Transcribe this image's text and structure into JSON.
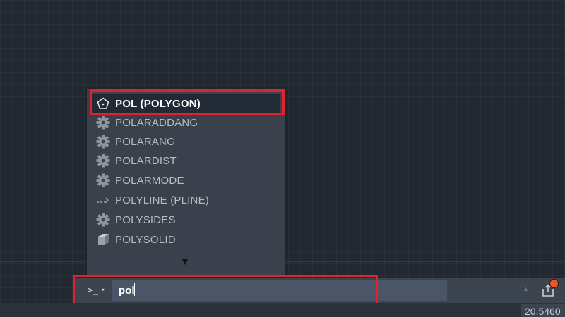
{
  "autocomplete": {
    "items": [
      {
        "label": "POL (POLYGON)",
        "icon": "polygon-icon",
        "selected": true
      },
      {
        "label": "POLARADDANG",
        "icon": "gear-icon"
      },
      {
        "label": "POLARANG",
        "icon": "gear-icon"
      },
      {
        "label": "POLARDIST",
        "icon": "gear-icon"
      },
      {
        "label": "POLARMODE",
        "icon": "gear-icon"
      },
      {
        "label": "POLYLINE (PLINE)",
        "icon": "polyline-icon"
      },
      {
        "label": "POLYSIDES",
        "icon": "gear-icon"
      },
      {
        "label": "POLYSOLID",
        "icon": "polysolid-icon"
      }
    ],
    "more_indicator": "▼"
  },
  "command_line": {
    "prompt_symbol": ">_",
    "dropdown_symbol": "▾",
    "input_value": "pol",
    "history_arrow": "▲"
  },
  "status": {
    "coordinate": "20.5460"
  },
  "colors": {
    "highlight_border": "#e0212e",
    "notification": "#e8562a"
  }
}
